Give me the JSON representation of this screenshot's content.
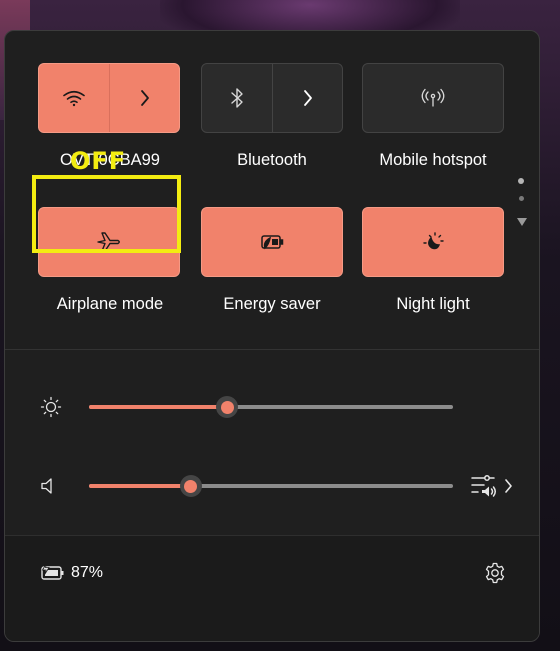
{
  "annotation": {
    "off_text": "OFF",
    "highlight_color": "#f3ec11"
  },
  "colors": {
    "accent": "#f1826b",
    "panel_bg": "#1f1f1f",
    "tile_off_bg": "#2b2b2b"
  },
  "quick_settings": {
    "tiles": [
      {
        "label": "OVT-0CBA99",
        "icon": "wifi-icon",
        "state": "on",
        "has_chevron": true
      },
      {
        "label": "Bluetooth",
        "icon": "bluetooth-icon",
        "state": "off",
        "has_chevron": true
      },
      {
        "label": "Mobile hotspot",
        "icon": "hotspot-icon",
        "state": "off",
        "has_chevron": false
      },
      {
        "label": "Airplane mode",
        "icon": "airplane-icon",
        "state": "on",
        "has_chevron": false
      },
      {
        "label": "Energy saver",
        "icon": "energy-saver-icon",
        "state": "on",
        "has_chevron": false
      },
      {
        "label": "Night light",
        "icon": "night-light-icon",
        "state": "on",
        "has_chevron": false
      }
    ],
    "pager": {
      "pages": 2,
      "current": 1
    }
  },
  "sliders": {
    "brightness": {
      "icon": "brightness-icon",
      "value_fraction": 0.38
    },
    "volume": {
      "icon": "speaker-icon",
      "value_fraction": 0.28,
      "extra_icon": "audio-output-icon"
    }
  },
  "footer": {
    "battery_icon": "battery-charging-icon",
    "battery_text": "87%",
    "settings_icon": "gear-icon"
  }
}
